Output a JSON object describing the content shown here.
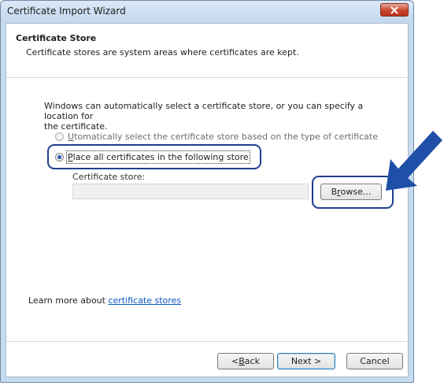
{
  "window": {
    "title": "Certificate Import Wizard"
  },
  "header": {
    "title": "Certificate Store",
    "description": "Certificate stores are system areas where certificates are kept."
  },
  "body": {
    "intro_line1": "Windows can automatically select a certificate store, or you can specify a location for",
    "intro_line2": "the certificate.",
    "option_auto": {
      "accel": "U",
      "rest": "tomatically select the certificate store based on the type of certificate",
      "selected": false
    },
    "option_place": {
      "accel": "P",
      "rest": "lace all certificates in the following store",
      "selected": true
    },
    "store_label": "Certificate store:",
    "store_value": "",
    "browse_accel": "r",
    "browse_pre": "B",
    "browse_post": "owse..."
  },
  "footer": {
    "learn_prefix": "Learn more about ",
    "learn_link": "certificate stores",
    "back_pre": "< ",
    "back_accel": "B",
    "back_post": "ack",
    "next_label": "Next >",
    "cancel_label": "Cancel"
  },
  "colors": {
    "highlight": "#1f3f8f",
    "arrow": "#1f4fa6",
    "link": "#0a56c2"
  },
  "icons": {
    "close": "close-x-icon",
    "arrow": "pointer-arrow-icon"
  }
}
